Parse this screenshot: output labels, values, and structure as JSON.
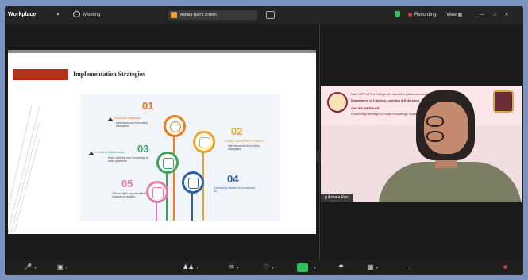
{
  "titlebar": {
    "app_name": "Workplace",
    "meeting_label": "Meeting",
    "share_label": "Ashala Rao's screen",
    "recording_label": "Recording",
    "view_label": "View"
  },
  "slide": {
    "heading": "Implementation Strategies",
    "steps": [
      {
        "number": "01",
        "title": "Curriculum Integration",
        "text": "Use resources from many disciplines"
      },
      {
        "number": "02",
        "title": "Faculty Development Programs",
        "text": "Use resources from many disciplines"
      },
      {
        "number": "03",
        "title": "Promoting Collaboration",
        "text": "Have students use technology to solve problems"
      },
      {
        "number": "04",
        "title": "Community Based Co Curriculum Ac",
        "text": ""
      },
      {
        "number": "05",
        "title": "",
        "text": "Give multiple opportunities for students to access"
      }
    ]
  },
  "video": {
    "banner_line1": "Kaur MSP's Pilot College of Education (Autonomous), Dindori",
    "banner_line2": "Department of Lifelong Learning & Extension",
    "banner_line3": "ONLINE WEBINAR",
    "banner_line4": "Preserving Heritage & Indian Knowledge Systems",
    "participant_name": "Ashala Rao"
  },
  "colors": {
    "accent_red": "#b5301c",
    "step_orange": "#f07a1c",
    "step_yellow": "#e8a52a",
    "step_green": "#3aa55a",
    "step_blue": "#2a5fa8",
    "step_pink": "#e87aa8",
    "recording": "#e03a3a",
    "share_green": "#2ec15a"
  },
  "toolbar": {
    "icons": [
      "mic-icon",
      "video-icon",
      "participants-icon",
      "chat-icon",
      "reactions-icon",
      "share-icon",
      "security-icon",
      "apps-icon",
      "more-icon",
      "leave-icon"
    ]
  }
}
